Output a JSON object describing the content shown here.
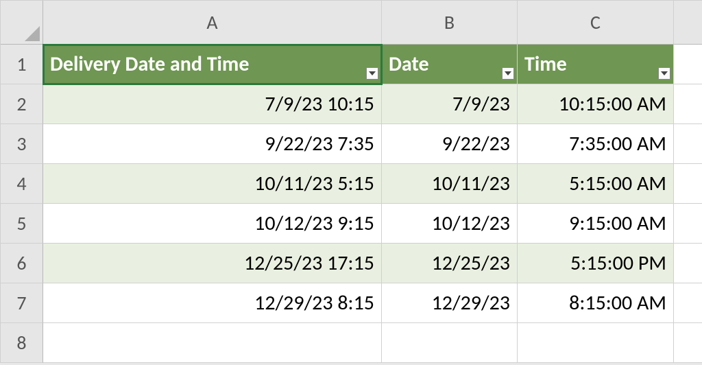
{
  "columns": [
    "A",
    "B",
    "C"
  ],
  "rows": [
    "1",
    "2",
    "3",
    "4",
    "5",
    "6",
    "7",
    "8"
  ],
  "headers": {
    "A": "Delivery Date and Time",
    "B": "Date",
    "C": "Time"
  },
  "table": [
    {
      "A": "7/9/23 10:15",
      "B": "7/9/23",
      "C": "10:15:00 AM"
    },
    {
      "A": "9/22/23 7:35",
      "B": "9/22/23",
      "C": "7:35:00 AM"
    },
    {
      "A": "10/11/23 5:15",
      "B": "10/11/23",
      "C": "5:15:00 AM"
    },
    {
      "A": "10/12/23 9:15",
      "B": "10/12/23",
      "C": "9:15:00 AM"
    },
    {
      "A": "12/25/23 17:15",
      "B": "12/25/23",
      "C": "5:15:00 PM"
    },
    {
      "A": "12/29/23 8:15",
      "B": "12/29/23",
      "C": "8:15:00 AM"
    }
  ]
}
